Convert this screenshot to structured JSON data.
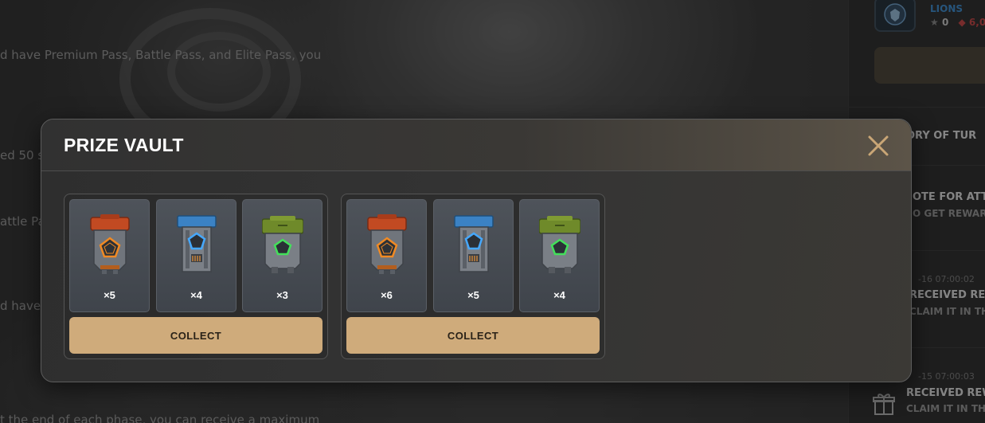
{
  "background": {
    "lines": [
      "d have Premium Pass, Battle Pass, and Elite Pass, you",
      "ed 50 s",
      "attle Pa",
      "d have",
      "t the end of each phase, you can receive a maximum"
    ]
  },
  "sidebar": {
    "team_name": "LIONS",
    "stars": "0",
    "gems": "6,0",
    "items": [
      {
        "title": "ORY OF TUR"
      },
      {
        "title": "OTE FOR ATTA",
        "sub": "O GET REWAR"
      },
      {
        "date": "-16 07:00:02",
        "title": "RECEIVED REW",
        "sub": "CLAIM IT IN THE"
      },
      {
        "date": "-15 07:00:03",
        "title": "RECEIVED REW",
        "sub": "CLAIM IT IN TH"
      }
    ]
  },
  "modal": {
    "title": "PRIZE VAULT",
    "groups": [
      {
        "collect_label": "COLLECT",
        "items": [
          {
            "icon": "orange-crate-icon",
            "qty": "×5"
          },
          {
            "icon": "blue-crate-icon",
            "qty": "×4"
          },
          {
            "icon": "green-crate-icon",
            "qty": "×3"
          }
        ]
      },
      {
        "collect_label": "COLLECT",
        "items": [
          {
            "icon": "orange-crate-icon",
            "qty": "×6"
          },
          {
            "icon": "blue-crate-icon",
            "qty": "×5"
          },
          {
            "icon": "green-crate-icon",
            "qty": "×4"
          }
        ]
      }
    ]
  },
  "colors": {
    "accent": "#cfab7b",
    "orange": "#c24a22",
    "blue": "#3b82c4",
    "green": "#6f8a2a",
    "team_blue": "#3b8fd6"
  }
}
